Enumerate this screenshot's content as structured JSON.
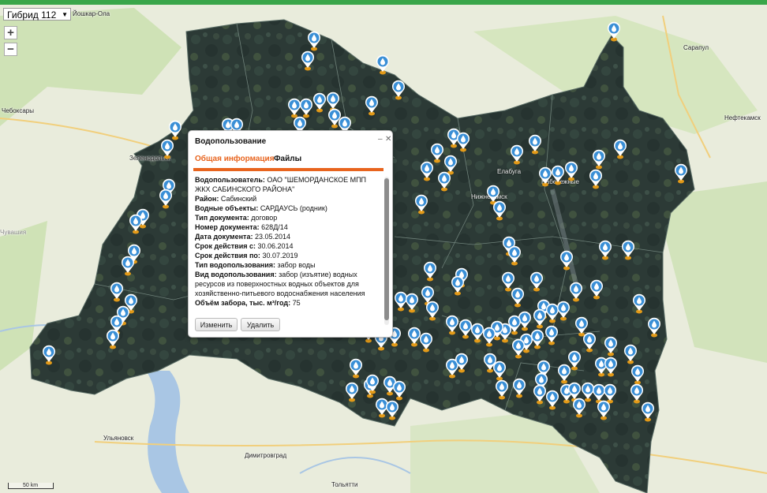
{
  "basemap": {
    "label": "Гибрид 112"
  },
  "zoom": {
    "in": "+",
    "out": "−"
  },
  "cities": [
    {
      "name": "Йошкар-Ола"
    },
    {
      "name": "Чебоксары"
    },
    {
      "name": "Зеленодольск"
    },
    {
      "name": "Елабуга"
    },
    {
      "name": "Набережные"
    },
    {
      "name": "Нижнекамск"
    },
    {
      "name": "Сарапул"
    },
    {
      "name": "Нефтекамск"
    },
    {
      "name": "Ульяновск"
    },
    {
      "name": "Димитровград"
    },
    {
      "name": "Тольятти"
    },
    {
      "name": "Чувашия"
    }
  ],
  "scale": {
    "label": "50 km"
  },
  "colors": {
    "accent": "#e8641e",
    "marker": "#3a8fd6",
    "marker_pin": "#e39a18",
    "region": "#2f3d38"
  },
  "popup": {
    "title": "Водопользование",
    "controls": {
      "minimize": "–",
      "close": "✕"
    },
    "tabs": [
      "Общая информация",
      "Файлы"
    ],
    "active_tab": "Общая информация",
    "fields": [
      {
        "label": "Водопользователь:",
        "value": "ОАО \"ШЕМОРДАНСКОЕ МПП ЖКХ САБИНСКОГО РАЙОНА\""
      },
      {
        "label": "Район:",
        "value": "Сабинский"
      },
      {
        "label": "Водные объекты:",
        "value": "САРДАУСЬ (родник)"
      },
      {
        "label": "Тип документа:",
        "value": "договор"
      },
      {
        "label": "Номер документа:",
        "value": "628Д/14"
      },
      {
        "label": "Дата документа:",
        "value": "23.05.2014"
      },
      {
        "label": "Срок действия с:",
        "value": "30.06.2014"
      },
      {
        "label": "Срок действия по:",
        "value": "30.07.2019"
      },
      {
        "label": "Тип водопользования:",
        "value": "забор воды"
      },
      {
        "label": "Вид водопользования:",
        "value": "забор (изъятие) водных ресурсов из поверхностных водных объектов для хозяйственно-питьевого водоснабжения населения"
      },
      {
        "label": "Объём забора, тыс. м³/год:",
        "value": "75"
      }
    ],
    "buttons": {
      "edit": "Изменить",
      "delete": "Удалить"
    }
  }
}
